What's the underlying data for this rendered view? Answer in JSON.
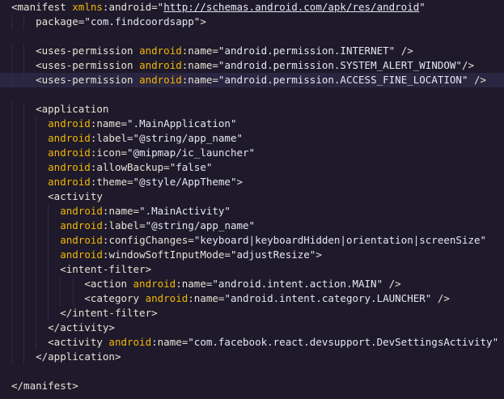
{
  "theme": {
    "background": "#1e1a2b",
    "highlight_line": "#2a2540",
    "tag_color": "#e8e3d6",
    "attr_color": "#f2b705",
    "string_color": "#e6e6f0"
  },
  "lines": [
    "<manifest xmlns:android=\"http://schemas.android.com/apk/res/android\"",
    "    package=\"com.findcoordsapp\">",
    "",
    "    <uses-permission android:name=\"android.permission.INTERNET\" />",
    "    <uses-permission android:name=\"android.permission.SYSTEM_ALERT_WINDOW\"/>",
    "    <uses-permission android:name=\"android.permission.ACCESS_FINE_LOCATION\" />",
    "",
    "    <application",
    "      android:name=\".MainApplication\"",
    "      android:label=\"@string/app_name\"",
    "      android:icon=\"@mipmap/ic_launcher\"",
    "      android:allowBackup=\"false\"",
    "      android:theme=\"@style/AppTheme\">",
    "      <activity",
    "        android:name=\".MainActivity\"",
    "        android:label=\"@string/app_name\"",
    "        android:configChanges=\"keyboard|keyboardHidden|orientation|screenSize\"",
    "        android:windowSoftInputMode=\"adjustResize\">",
    "        <intent-filter>",
    "            <action android:name=\"android.intent.action.MAIN\" />",
    "            <category android:name=\"android.intent.category.LAUNCHER\" />",
    "        </intent-filter>",
    "      </activity>",
    "      <activity android:name=\"com.facebook.react.devsupport.DevSettingsActivity\" />",
    "    </application>",
    "",
    "</manifest>"
  ],
  "current_line_index": 5
}
